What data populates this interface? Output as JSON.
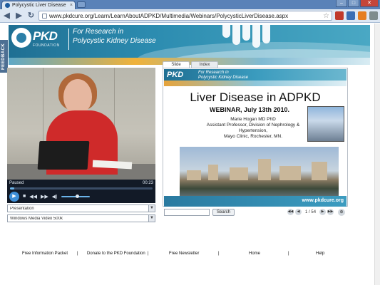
{
  "browser": {
    "tab_title": "Polycystic Liver Disease",
    "tab_close": "×",
    "url": "www.pkdcure.org/Learn/LearnAboutADPKD/Multimedia/Webinars/PolycysticLiverDisease.aspx",
    "nav": {
      "back": "◀",
      "forward": "▶",
      "reload": "↻",
      "star": "☆"
    },
    "window": {
      "minimize": "–",
      "maximize": "□",
      "close": "✕"
    }
  },
  "banner": {
    "logo": "PKD",
    "logo_sub": "FOUNDATION",
    "tagline_line1": "For Research in",
    "tagline_line2": "Polycystic Kidney Disease"
  },
  "feedback_label": "FEEDBACK",
  "video": {
    "status": "Paused",
    "time": "00:23",
    "progress": 0.03,
    "volume": 0.55,
    "controls": {
      "play": "▶",
      "stop": "■",
      "prev": "◀◀",
      "next": "▶▶",
      "mute": "◀)"
    },
    "presentation_select": "Presentation",
    "format_select": "Windows Media Video 500k"
  },
  "slides": {
    "tabs": [
      "Slide",
      "Index"
    ],
    "logo": "PKD",
    "tagline_line1": "For Research in",
    "tagline_line2": "Polycystic Kidney Disease",
    "title": "Liver Disease in ADPKD",
    "subtitle": "WEBINAR, July 13th 2010.",
    "speaker_name": "Marie Hogan MD PhD",
    "speaker_line2": "Assistant Professor, Division of Nephrology &",
    "speaker_line3": "Hypertension,",
    "speaker_line4": "Mayo Clinic, Rochester, MN.",
    "footer_url": "www.pkdcure.org",
    "search_button": "Search",
    "pager_text": "1 / 54"
  },
  "footer": {
    "links": [
      "Free Information Packet",
      "Donate to the PKD Foundation",
      "Free Newsletter",
      "Home",
      "Help"
    ],
    "separator": "|"
  },
  "colors": {
    "brand_blue": "#1f6f93",
    "accent_orange": "#f0b23a",
    "jacket_red": "#cf2a2a"
  }
}
